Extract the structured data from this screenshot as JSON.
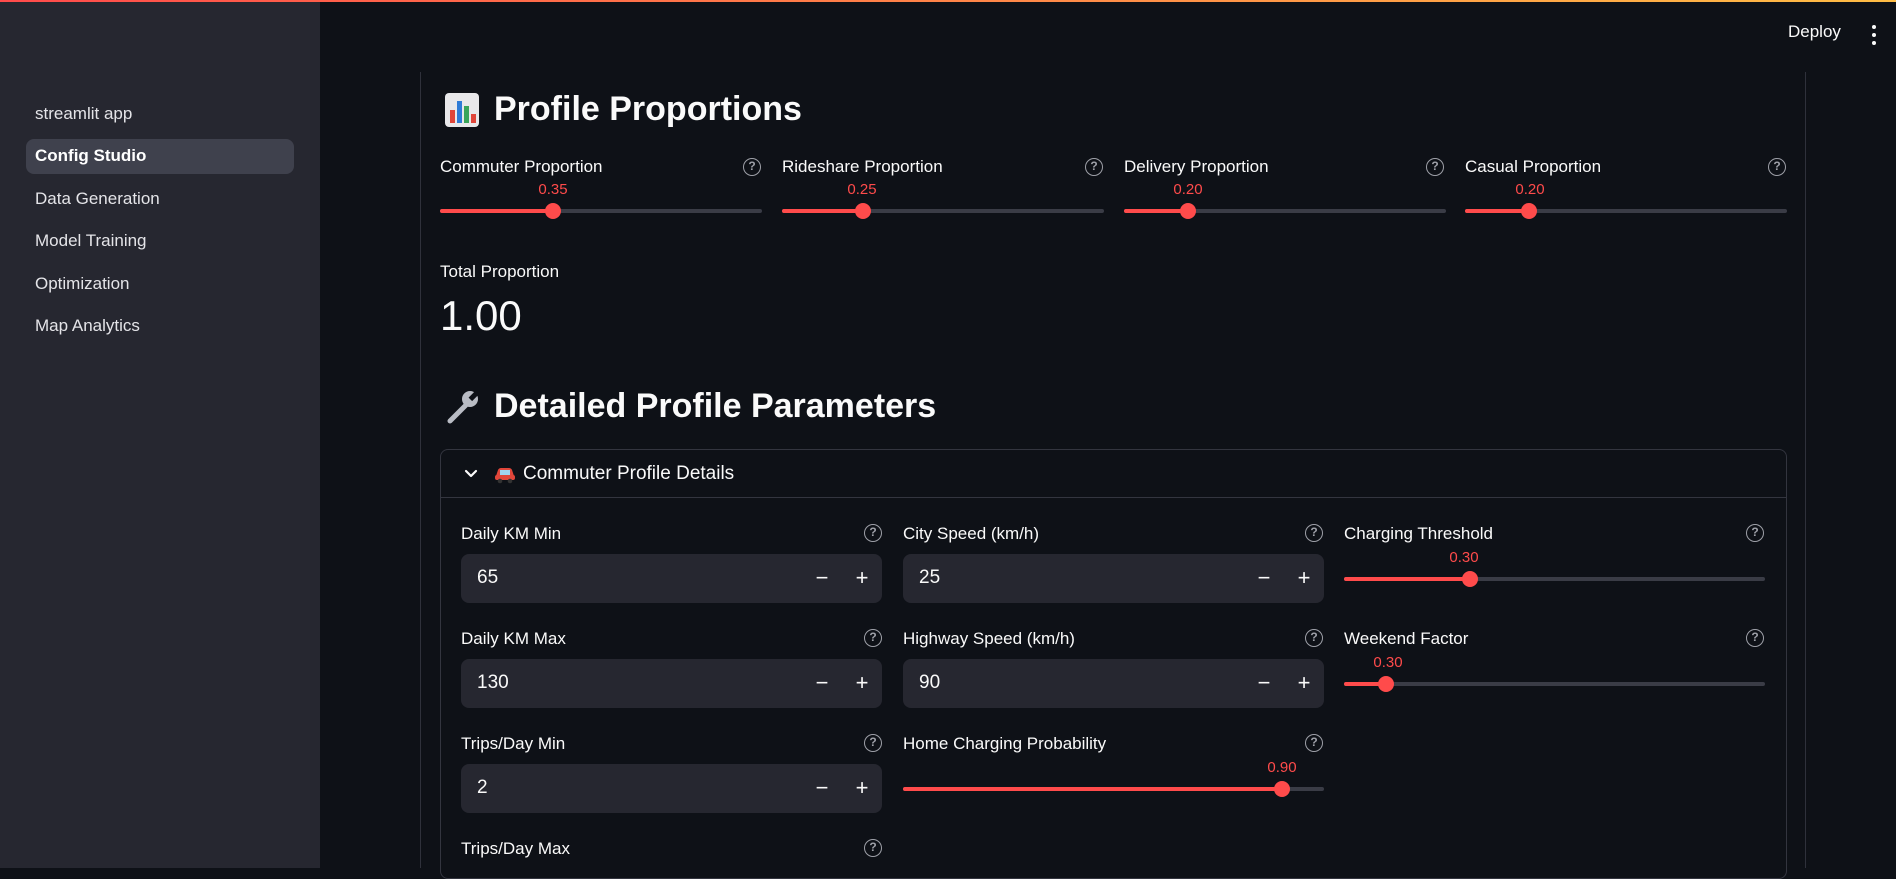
{
  "sidebar": {
    "items": [
      {
        "label": "streamlit app",
        "active": false
      },
      {
        "label": "Config Studio",
        "active": true
      },
      {
        "label": "Data Generation",
        "active": false
      },
      {
        "label": "Model Training",
        "active": false
      },
      {
        "label": "Optimization",
        "active": false
      },
      {
        "label": "Map Analytics",
        "active": false
      }
    ]
  },
  "header": {
    "deploy_label": "Deploy",
    "menu_icon": "kebab-menu-icon"
  },
  "proportions": {
    "title": "Profile Proportions",
    "icon": "bar-chart-icon",
    "sliders": [
      {
        "label": "Commuter Proportion",
        "value": "0.35",
        "fraction": 0.35
      },
      {
        "label": "Rideshare Proportion",
        "value": "0.25",
        "fraction": 0.25
      },
      {
        "label": "Delivery Proportion",
        "value": "0.20",
        "fraction": 0.2
      },
      {
        "label": "Casual Proportion",
        "value": "0.20",
        "fraction": 0.2
      }
    ],
    "total": {
      "label": "Total Proportion",
      "value": "1.00"
    }
  },
  "details": {
    "title": "Detailed Profile Parameters",
    "icon": "wrench-icon",
    "expander": {
      "label": "Commuter Profile Details",
      "icon": "car-icon",
      "expanded": true,
      "col1": [
        {
          "label": "Daily KM Min",
          "value": "65"
        },
        {
          "label": "Daily KM Max",
          "value": "130"
        },
        {
          "label": "Trips/Day Min",
          "value": "2"
        },
        {
          "label": "Trips/Day Max",
          "value": ""
        }
      ],
      "col2": {
        "city_speed": {
          "label": "City Speed (km/h)",
          "value": "25"
        },
        "highway_speed": {
          "label": "Highway Speed (km/h)",
          "value": "90"
        },
        "home_charging": {
          "label": "Home Charging Probability",
          "value": "0.90",
          "fraction": 0.9
        }
      },
      "col3": {
        "charging_threshold": {
          "label": "Charging Threshold",
          "value": "0.30",
          "fraction": 0.3
        },
        "weekend_factor": {
          "label": "Weekend Factor",
          "value": "0.30",
          "fraction": 0.1
        }
      }
    }
  },
  "colors": {
    "accent": "#ff4b4b",
    "bg": "#0e1117",
    "sidebar": "#262730"
  }
}
